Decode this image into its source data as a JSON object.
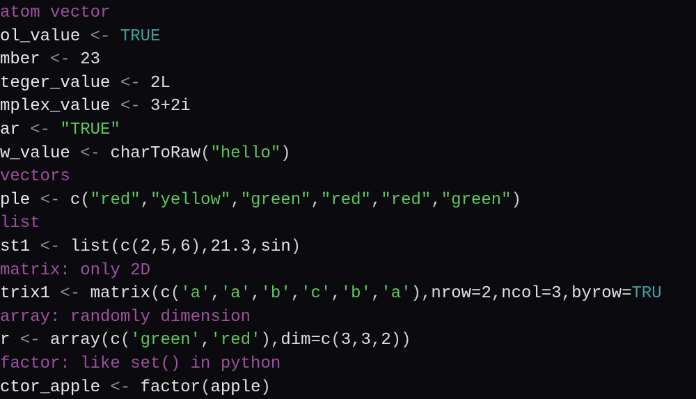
{
  "lines": {
    "l1_comment": "atom vector",
    "l2_var": "ol_value",
    "l2_op": " <- ",
    "l2_val": "TRUE",
    "l3_var": "mber",
    "l3_op": " <- ",
    "l3_val": "23",
    "l4_var": "teger_value",
    "l4_op": " <- ",
    "l4_val": "2L",
    "l5_var": "mplex_value",
    "l5_op": " <- ",
    "l5_val": "3+2i",
    "l6_var": "ar",
    "l6_op": " <- ",
    "l6_val": "\"TRUE\"",
    "l7_var": "w_value",
    "l7_op": " <- ",
    "l7_func": "charToRaw",
    "l7_p1": "(",
    "l7_arg": "\"hello\"",
    "l7_p2": ")",
    "l8_comment": "vectors",
    "l9_var": "ple",
    "l9_op": " <- ",
    "l9_func": "c",
    "l9_p1": "(",
    "l9_s1": "\"red\"",
    "l9_c1": ",",
    "l9_s2": "\"yellow\"",
    "l9_c2": ",",
    "l9_s3": "\"green\"",
    "l9_c3": ",",
    "l9_s4": "\"red\"",
    "l9_c4": ",",
    "l9_s5": "\"red\"",
    "l9_c5": ",",
    "l9_s6": "\"green\"",
    "l9_p2": ")",
    "l10_comment": "list",
    "l11_var": "st1",
    "l11_op": " <- ",
    "l11_func": "list",
    "l11_p1": "(",
    "l11_func2": "c",
    "l11_p2": "(",
    "l11_n1": "2",
    "l11_c1": ",",
    "l11_n2": "5",
    "l11_c2": ",",
    "l11_n3": "6",
    "l11_p3": ")",
    "l11_c3": ",",
    "l11_n4": "21.3",
    "l11_c4": ",",
    "l11_sin": "sin",
    "l11_p4": ")",
    "l12_comment": "matrix: only 2D",
    "l13_var": "trix1",
    "l13_op": " <- ",
    "l13_func": "matrix",
    "l13_p1": "(",
    "l13_func2": "c",
    "l13_p2": "(",
    "l13_s1": "'a'",
    "l13_c1": ",",
    "l13_s2": "'a'",
    "l13_c2": ",",
    "l13_s3": "'b'",
    "l13_c3": ",",
    "l13_s4": "'c'",
    "l13_c4": ",",
    "l13_s5": "'b'",
    "l13_c5": ",",
    "l13_s6": "'a'",
    "l13_p3": ")",
    "l13_c6": ",",
    "l13_arg1": "nrow=",
    "l13_n1": "2",
    "l13_c7": ",",
    "l13_arg2": "ncol=",
    "l13_n2": "3",
    "l13_c8": ",",
    "l13_arg3": "byrow=",
    "l13_val": "TRU",
    "l14_comment": "array: randomly dimension",
    "l15_var": "r",
    "l15_op": " <- ",
    "l15_func": "array",
    "l15_p1": "(",
    "l15_func2": "c",
    "l15_p2": "(",
    "l15_s1": "'green'",
    "l15_c1": ",",
    "l15_s2": "'red'",
    "l15_p3": ")",
    "l15_c2": ",",
    "l15_arg": "dim=",
    "l15_func3": "c",
    "l15_p4": "(",
    "l15_n1": "3",
    "l15_c3": ",",
    "l15_n2": "3",
    "l15_c4": ",",
    "l15_n3": "2",
    "l15_p5": ")",
    "l15_p6": ")",
    "l16_comment": "factor: like set() in python",
    "l17_var": "ctor_apple",
    "l17_op": " <- ",
    "l17_func": "factor",
    "l17_p1": "(",
    "l17_arg": "apple",
    "l17_p2": ")"
  }
}
